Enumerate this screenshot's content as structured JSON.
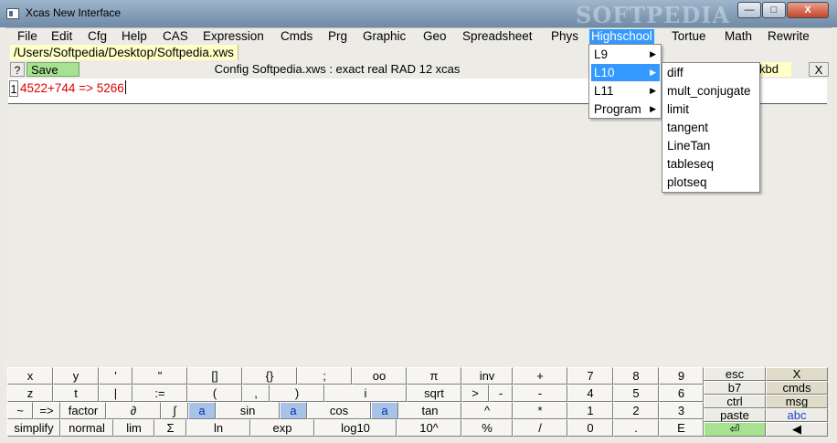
{
  "window": {
    "title": "Xcas New Interface",
    "watermark": "SOFTPEDIA",
    "min_label": "—",
    "max_label": "□",
    "close_label": "X"
  },
  "menubar": [
    "File",
    "Edit",
    "Cfg",
    "Help",
    "CAS",
    "Expression",
    "Cmds",
    "Prg",
    "Graphic",
    "Geo",
    "Spreadsheet",
    "Phys",
    "Highschool",
    "Tortue",
    "Math",
    "Rewrite"
  ],
  "tab": {
    "path": "/Users/Softpedia/Desktop/Softpedia.xws"
  },
  "session_header": {
    "help_label": "?",
    "save_label": "Save",
    "config": "Config Softpedia.xws : exact real RAD 12 xcas",
    "kbd_label": "kbd",
    "close_label": "X"
  },
  "session": {
    "line_number": "1",
    "command": "4522+744 => 5266"
  },
  "highschool_menu": {
    "items": [
      "L9",
      "L10",
      "L11",
      "Program"
    ],
    "highlighted": "L10"
  },
  "l10_menu": {
    "items": [
      "diff",
      "mult_conjugate",
      "limit",
      "tangent",
      "LineTan",
      "tableseq",
      "plotseq"
    ]
  },
  "keypad": {
    "rows": [
      [
        "x",
        "y",
        "'",
        "\"",
        "[]",
        "{}",
        ";",
        "oo",
        "π",
        "inv",
        "+",
        "7",
        "8",
        "9"
      ],
      [
        "z",
        "t",
        "|",
        ":=",
        "(",
        ",",
        ")",
        "i",
        "sqrt",
        ">",
        "-",
        "-",
        "4",
        "5",
        "6"
      ],
      [
        "~",
        "=>",
        "factor",
        "∂",
        "∫",
        "a",
        "sin",
        "a",
        "cos",
        "a",
        "tan",
        "^",
        "*",
        "1",
        "2",
        "3"
      ],
      [
        "simplify",
        "normal",
        "lim",
        "Σ",
        "ln",
        "exp",
        "log10",
        "10^",
        "%",
        "/",
        "0",
        ".",
        "E"
      ]
    ],
    "side": [
      [
        "esc",
        "X"
      ],
      [
        "b7",
        "cmds"
      ],
      [
        "ctrl",
        "msg"
      ],
      [
        "paste",
        "abc"
      ],
      [
        "⏎",
        "◀"
      ]
    ]
  },
  "colors": {
    "menu_highlight": "#3399ff",
    "save_green": "#a6e28f",
    "command_red": "#e00000",
    "tab_yellow": "#ffffc8"
  }
}
